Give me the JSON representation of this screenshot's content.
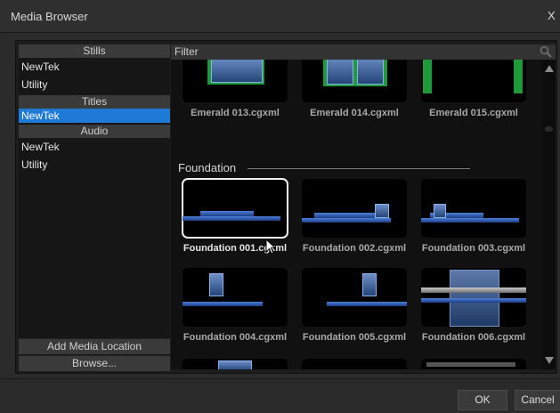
{
  "window": {
    "title": "Media Browser",
    "close_label": "X"
  },
  "sidebar": {
    "sections": [
      {
        "header": "Stills",
        "items": [
          {
            "label": "NewTek"
          },
          {
            "label": "Utility"
          }
        ]
      },
      {
        "header": "Titles",
        "items": [
          {
            "label": "NewTek",
            "selected": true
          }
        ]
      },
      {
        "header": "Audio",
        "items": [
          {
            "label": "NewTek"
          },
          {
            "label": "Utility"
          }
        ]
      }
    ],
    "add_location_label": "Add Media Location",
    "browse_label": "Browse..."
  },
  "filter": {
    "label": "Filter"
  },
  "content": {
    "emerald_items": [
      {
        "label": "Emerald 013.cgxml"
      },
      {
        "label": "Emerald 014.cgxml"
      },
      {
        "label": "Emerald 015.cgxml"
      }
    ],
    "group_title": "Foundation",
    "foundation_items": [
      {
        "label": "Foundation 001.cgxml",
        "selected": true
      },
      {
        "label": "Foundation 002.cgxml"
      },
      {
        "label": "Foundation 003.cgxml"
      },
      {
        "label": "Foundation 004.cgxml"
      },
      {
        "label": "Foundation 005.cgxml"
      },
      {
        "label": "Foundation 006.cgxml"
      }
    ]
  },
  "footer": {
    "ok_label": "OK",
    "cancel_label": "Cancel"
  },
  "colors": {
    "accent": "#1f7ad6",
    "background": "#2b2b2b"
  }
}
